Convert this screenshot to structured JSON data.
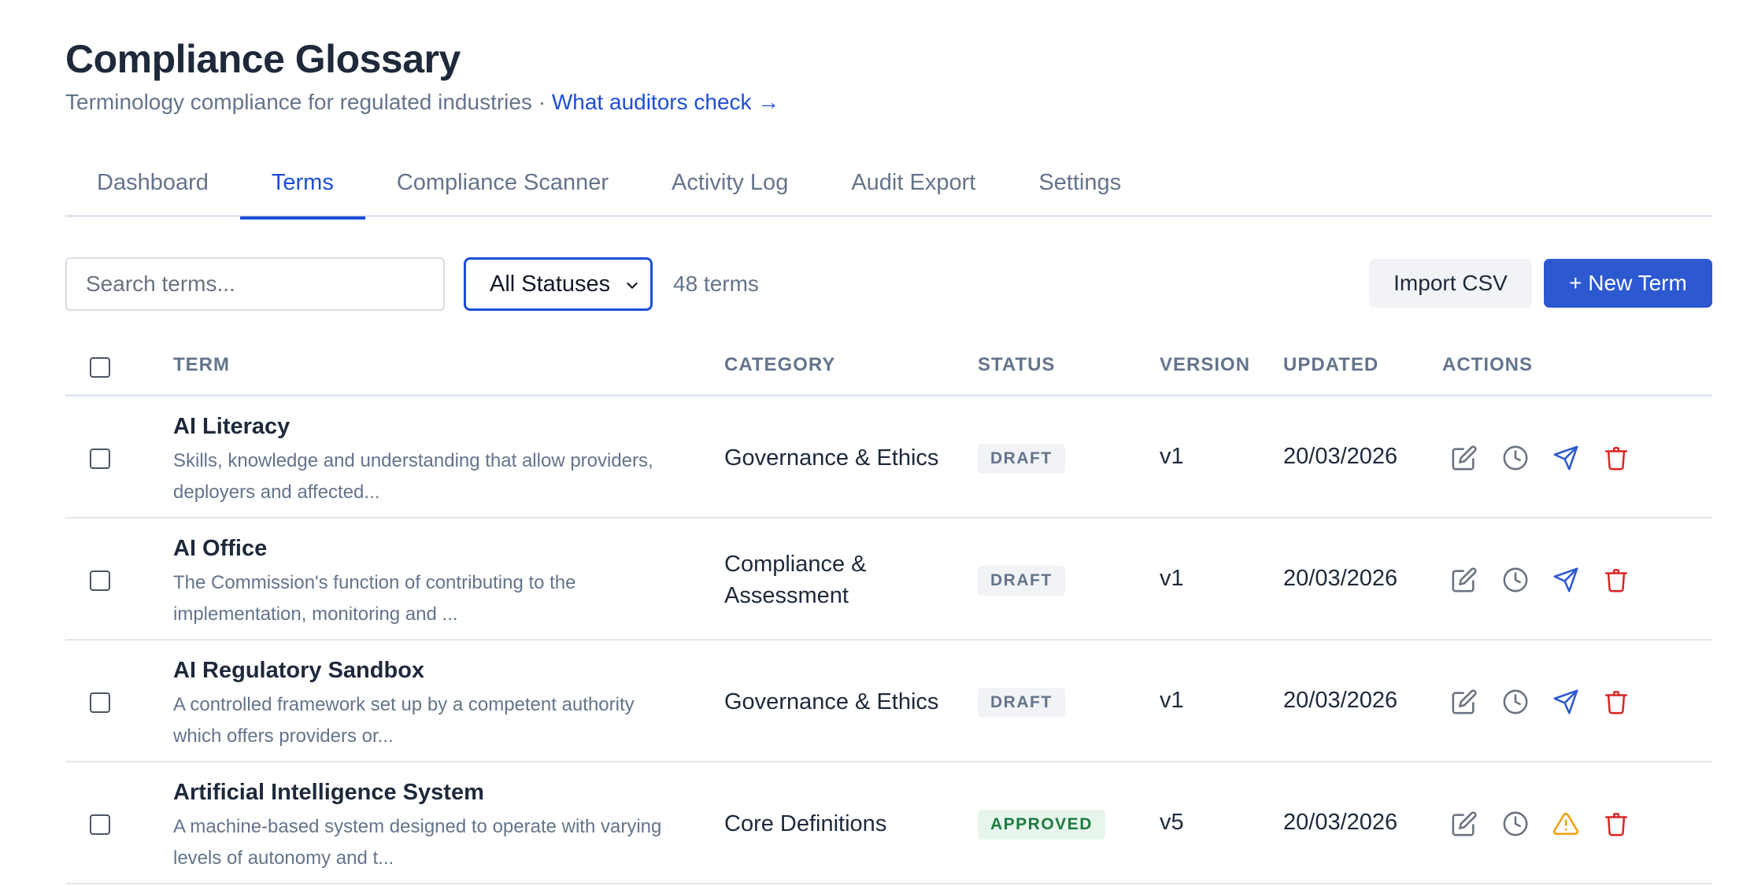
{
  "header": {
    "title": "Compliance Glossary",
    "subtitle": "Terminology compliance for regulated industries · ",
    "link": "What auditors check →"
  },
  "tabs": [
    {
      "label": "Dashboard",
      "active": false
    },
    {
      "label": "Terms",
      "active": true
    },
    {
      "label": "Compliance Scanner",
      "active": false
    },
    {
      "label": "Activity Log",
      "active": false
    },
    {
      "label": "Audit Export",
      "active": false
    },
    {
      "label": "Settings",
      "active": false
    }
  ],
  "toolbar": {
    "search_placeholder": "Search terms...",
    "status_filter": "All Statuses",
    "count": "48 terms",
    "import_label": "Import CSV",
    "new_label": "+ New Term"
  },
  "table": {
    "headers": {
      "term": "TERM",
      "category": "CATEGORY",
      "status": "STATUS",
      "version": "VERSION",
      "updated": "UPDATED",
      "actions": "ACTIONS"
    },
    "rows": [
      {
        "name": "AI Literacy",
        "description": "Skills, knowledge and understanding that allow providers, deployers and affected...",
        "category": "Governance & Ethics",
        "status": "DRAFT",
        "version": "v1",
        "updated": "20/03/2026",
        "third_action_icon": "send-icon"
      },
      {
        "name": "AI Office",
        "description": "The Commission's function of contributing to the implementation, monitoring and ...",
        "category": "Compliance & Assessment",
        "status": "DRAFT",
        "version": "v1",
        "updated": "20/03/2026",
        "third_action_icon": "send-icon"
      },
      {
        "name": "AI Regulatory Sandbox",
        "description": "A controlled framework set up by a competent authority which offers providers or...",
        "category": "Governance & Ethics",
        "status": "DRAFT",
        "version": "v1",
        "updated": "20/03/2026",
        "third_action_icon": "send-icon"
      },
      {
        "name": "Artificial Intelligence System",
        "description": "A machine-based system designed to operate with varying levels of autonomy and t...",
        "category": "Core Definitions",
        "status": "APPROVED",
        "version": "v5",
        "updated": "20/03/2026",
        "third_action_icon": "warning-icon"
      }
    ]
  },
  "colors": {
    "accent": "#2d59d0",
    "link": "#1d4ed8",
    "send_icon": "#2d59d0",
    "warning_icon": "#f59e0b",
    "delete_icon": "#dc2626",
    "muted_icon": "#6b7280"
  }
}
